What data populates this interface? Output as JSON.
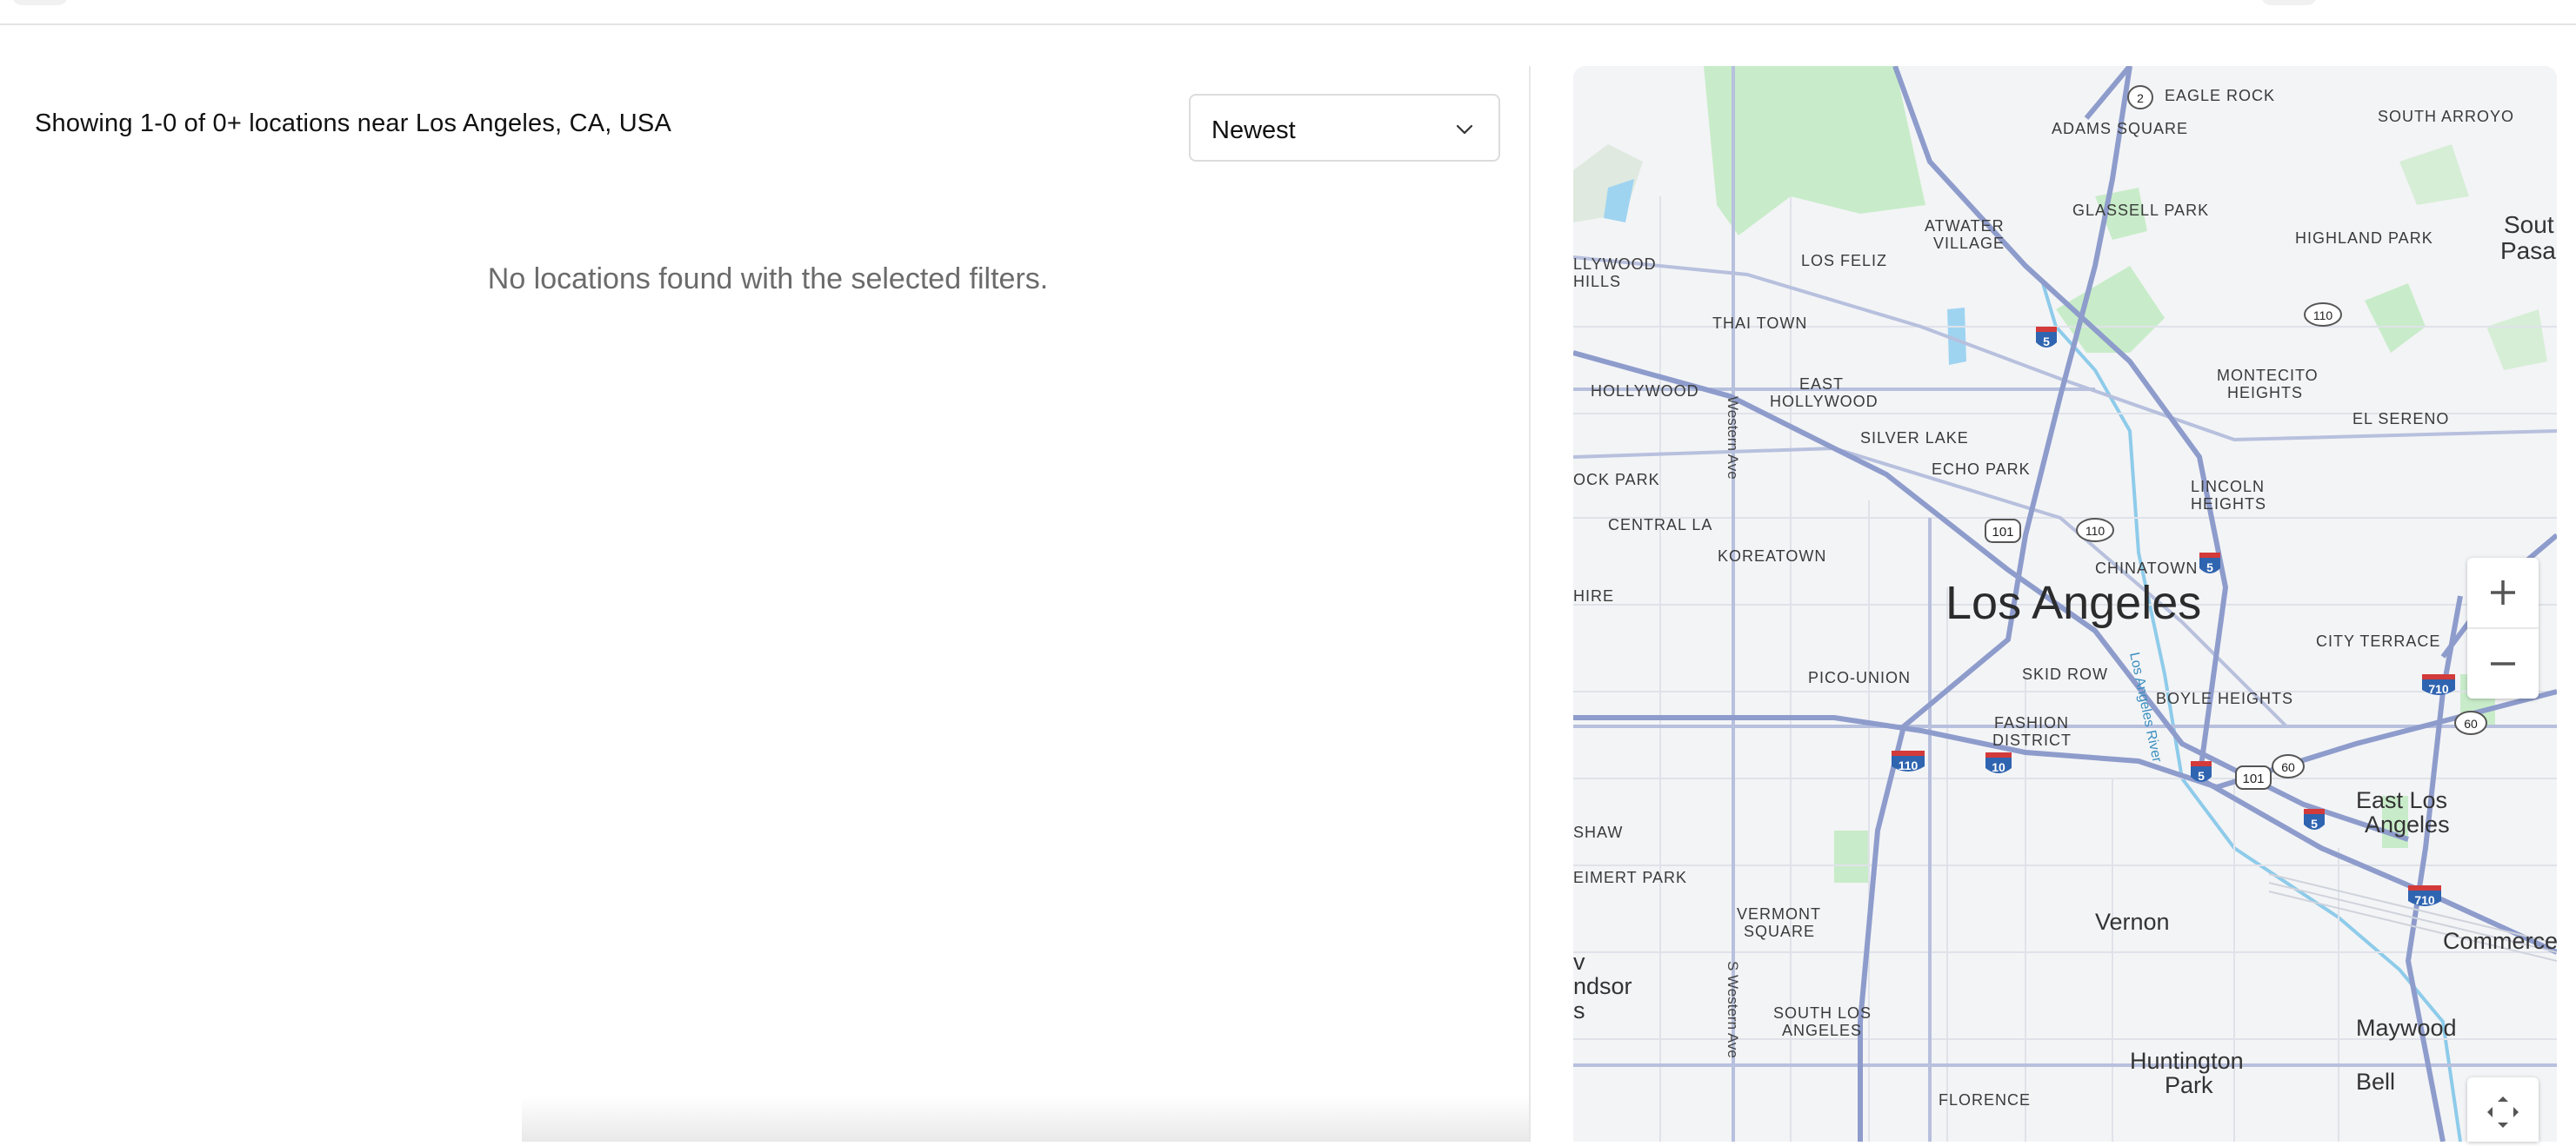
{
  "results": {
    "summary": "Showing 1-0 of 0+ locations near Los Angeles, CA, USA",
    "empty_message": "No locations found with the selected filters."
  },
  "sort": {
    "selected": "Newest"
  },
  "map": {
    "labels": {
      "los_angeles": "Los Angeles",
      "eagle_rock": "EAGLE ROCK",
      "adams_square": "ADAMS SQUARE",
      "south_arroyo": "SOUTH ARROYO",
      "atwater_1": "ATWATER",
      "atwater_2": "VILLAGE",
      "glassell_park": "GLASSELL PARK",
      "highland_park": "HIGHLAND PARK",
      "south_pasadena_1": "Sout",
      "south_pasadena_2": "Pasade",
      "hollywood_hills_1": "LLYWOOD",
      "hollywood_hills_2": "HILLS",
      "los_feliz": "LOS FELIZ",
      "thai_town": "THAI TOWN",
      "monteito_1": "MONTECITO",
      "monteito_2": "HEIGHTS",
      "east_hollywood_1": "EAST",
      "east_hollywood_2": "HOLLYWOOD",
      "hollywood": "HOLLYWOOD",
      "silver_lake": "SILVER LAKE",
      "el_sereno": "EL SERENO",
      "echo_park": "ECHO PARK",
      "lincoln_heights_1": "LINCOLN",
      "lincoln_heights_2": "HEIGHTS",
      "rock_park": "OCK PARK",
      "central_la": "CENTRAL LA",
      "koreatown": "KOREATOWN",
      "chinatown": "CHINATOWN",
      "shire": "HIRE",
      "city_terrace": "CITY TERRACE",
      "pico_union": "PICO-UNION",
      "skid_row": "SKID ROW",
      "boyle_heights": "BOYLE HEIGHTS",
      "fashion_1": "FASHION",
      "fashion_2": "DISTRICT",
      "east_la_1": "East Los",
      "east_la_2": "Angeles",
      "shaw": "SHAW",
      "leimert_park": "EIMERT PARK",
      "vermont_sq_1": "VERMONT",
      "vermont_sq_2": "SQUARE",
      "vernon": "Vernon",
      "commerce": "Commerce",
      "windsor_1": "v",
      "windsor_2": "ndsor",
      "windsor_3": "s",
      "south_la_1": "SOUTH LOS",
      "south_la_2": "ANGELES",
      "maywood": "Maywood",
      "huntington_1": "Huntington",
      "huntington_2": "Park",
      "bell": "Bell",
      "florence": "FLORENCE",
      "western_ave": "Western Ave",
      "s_western_ave": "S Western Ave",
      "la_river": "Los Angeles River"
    },
    "shields": {
      "i5": "5",
      "i10": "10",
      "i110": "110",
      "i710": "710",
      "us101": "101",
      "ca2": "2",
      "ca60": "60",
      "ca110": "110"
    }
  },
  "colors": {
    "map_background": "#f3f4f6",
    "road": "#a6b2d4",
    "highway": "#8e9ccc",
    "park": "#c6ebc8",
    "water": "#9fd4f1",
    "interstate_shield": "#2f64b0",
    "interstate_top": "#d33a3a"
  },
  "icons": {
    "sort_chevron": "chevron-down-icon",
    "zoom_in": "plus-icon",
    "zoom_out": "minus-icon",
    "fullscreen": "fullscreen-icon"
  }
}
